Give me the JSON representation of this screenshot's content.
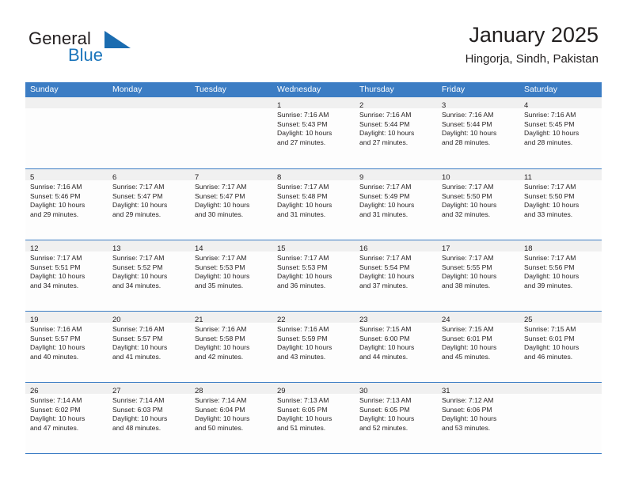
{
  "brand": {
    "general": "General",
    "blue": "Blue",
    "triangle_color": "#1b6cb0",
    "blue_color": "#1b75bb"
  },
  "header": {
    "title": "January 2025",
    "location": "Hingorja, Sindh, Pakistan"
  },
  "theme": {
    "header_blue": "#3c7dc4",
    "day_band_gray": "#f0f0f0",
    "cell_white": "#fdfdfd",
    "text_black": "#231f20"
  },
  "weekday_headers": [
    "Sunday",
    "Monday",
    "Tuesday",
    "Wednesday",
    "Thursday",
    "Friday",
    "Saturday"
  ],
  "weeks": [
    [
      {
        "day": "",
        "empty": true
      },
      {
        "day": "",
        "empty": true
      },
      {
        "day": "",
        "empty": true
      },
      {
        "day": "1",
        "sunrise": "Sunrise: 7:16 AM",
        "sunset": "Sunset: 5:43 PM",
        "daylight1": "Daylight: 10 hours",
        "daylight2": "and 27 minutes."
      },
      {
        "day": "2",
        "sunrise": "Sunrise: 7:16 AM",
        "sunset": "Sunset: 5:44 PM",
        "daylight1": "Daylight: 10 hours",
        "daylight2": "and 27 minutes."
      },
      {
        "day": "3",
        "sunrise": "Sunrise: 7:16 AM",
        "sunset": "Sunset: 5:44 PM",
        "daylight1": "Daylight: 10 hours",
        "daylight2": "and 28 minutes."
      },
      {
        "day": "4",
        "sunrise": "Sunrise: 7:16 AM",
        "sunset": "Sunset: 5:45 PM",
        "daylight1": "Daylight: 10 hours",
        "daylight2": "and 28 minutes."
      }
    ],
    [
      {
        "day": "5",
        "sunrise": "Sunrise: 7:16 AM",
        "sunset": "Sunset: 5:46 PM",
        "daylight1": "Daylight: 10 hours",
        "daylight2": "and 29 minutes."
      },
      {
        "day": "6",
        "sunrise": "Sunrise: 7:17 AM",
        "sunset": "Sunset: 5:47 PM",
        "daylight1": "Daylight: 10 hours",
        "daylight2": "and 29 minutes."
      },
      {
        "day": "7",
        "sunrise": "Sunrise: 7:17 AM",
        "sunset": "Sunset: 5:47 PM",
        "daylight1": "Daylight: 10 hours",
        "daylight2": "and 30 minutes."
      },
      {
        "day": "8",
        "sunrise": "Sunrise: 7:17 AM",
        "sunset": "Sunset: 5:48 PM",
        "daylight1": "Daylight: 10 hours",
        "daylight2": "and 31 minutes."
      },
      {
        "day": "9",
        "sunrise": "Sunrise: 7:17 AM",
        "sunset": "Sunset: 5:49 PM",
        "daylight1": "Daylight: 10 hours",
        "daylight2": "and 31 minutes."
      },
      {
        "day": "10",
        "sunrise": "Sunrise: 7:17 AM",
        "sunset": "Sunset: 5:50 PM",
        "daylight1": "Daylight: 10 hours",
        "daylight2": "and 32 minutes."
      },
      {
        "day": "11",
        "sunrise": "Sunrise: 7:17 AM",
        "sunset": "Sunset: 5:50 PM",
        "daylight1": "Daylight: 10 hours",
        "daylight2": "and 33 minutes."
      }
    ],
    [
      {
        "day": "12",
        "sunrise": "Sunrise: 7:17 AM",
        "sunset": "Sunset: 5:51 PM",
        "daylight1": "Daylight: 10 hours",
        "daylight2": "and 34 minutes."
      },
      {
        "day": "13",
        "sunrise": "Sunrise: 7:17 AM",
        "sunset": "Sunset: 5:52 PM",
        "daylight1": "Daylight: 10 hours",
        "daylight2": "and 34 minutes."
      },
      {
        "day": "14",
        "sunrise": "Sunrise: 7:17 AM",
        "sunset": "Sunset: 5:53 PM",
        "daylight1": "Daylight: 10 hours",
        "daylight2": "and 35 minutes."
      },
      {
        "day": "15",
        "sunrise": "Sunrise: 7:17 AM",
        "sunset": "Sunset: 5:53 PM",
        "daylight1": "Daylight: 10 hours",
        "daylight2": "and 36 minutes."
      },
      {
        "day": "16",
        "sunrise": "Sunrise: 7:17 AM",
        "sunset": "Sunset: 5:54 PM",
        "daylight1": "Daylight: 10 hours",
        "daylight2": "and 37 minutes."
      },
      {
        "day": "17",
        "sunrise": "Sunrise: 7:17 AM",
        "sunset": "Sunset: 5:55 PM",
        "daylight1": "Daylight: 10 hours",
        "daylight2": "and 38 minutes."
      },
      {
        "day": "18",
        "sunrise": "Sunrise: 7:17 AM",
        "sunset": "Sunset: 5:56 PM",
        "daylight1": "Daylight: 10 hours",
        "daylight2": "and 39 minutes."
      }
    ],
    [
      {
        "day": "19",
        "sunrise": "Sunrise: 7:16 AM",
        "sunset": "Sunset: 5:57 PM",
        "daylight1": "Daylight: 10 hours",
        "daylight2": "and 40 minutes."
      },
      {
        "day": "20",
        "sunrise": "Sunrise: 7:16 AM",
        "sunset": "Sunset: 5:57 PM",
        "daylight1": "Daylight: 10 hours",
        "daylight2": "and 41 minutes."
      },
      {
        "day": "21",
        "sunrise": "Sunrise: 7:16 AM",
        "sunset": "Sunset: 5:58 PM",
        "daylight1": "Daylight: 10 hours",
        "daylight2": "and 42 minutes."
      },
      {
        "day": "22",
        "sunrise": "Sunrise: 7:16 AM",
        "sunset": "Sunset: 5:59 PM",
        "daylight1": "Daylight: 10 hours",
        "daylight2": "and 43 minutes."
      },
      {
        "day": "23",
        "sunrise": "Sunrise: 7:15 AM",
        "sunset": "Sunset: 6:00 PM",
        "daylight1": "Daylight: 10 hours",
        "daylight2": "and 44 minutes."
      },
      {
        "day": "24",
        "sunrise": "Sunrise: 7:15 AM",
        "sunset": "Sunset: 6:01 PM",
        "daylight1": "Daylight: 10 hours",
        "daylight2": "and 45 minutes."
      },
      {
        "day": "25",
        "sunrise": "Sunrise: 7:15 AM",
        "sunset": "Sunset: 6:01 PM",
        "daylight1": "Daylight: 10 hours",
        "daylight2": "and 46 minutes."
      }
    ],
    [
      {
        "day": "26",
        "sunrise": "Sunrise: 7:14 AM",
        "sunset": "Sunset: 6:02 PM",
        "daylight1": "Daylight: 10 hours",
        "daylight2": "and 47 minutes."
      },
      {
        "day": "27",
        "sunrise": "Sunrise: 7:14 AM",
        "sunset": "Sunset: 6:03 PM",
        "daylight1": "Daylight: 10 hours",
        "daylight2": "and 48 minutes."
      },
      {
        "day": "28",
        "sunrise": "Sunrise: 7:14 AM",
        "sunset": "Sunset: 6:04 PM",
        "daylight1": "Daylight: 10 hours",
        "daylight2": "and 50 minutes."
      },
      {
        "day": "29",
        "sunrise": "Sunrise: 7:13 AM",
        "sunset": "Sunset: 6:05 PM",
        "daylight1": "Daylight: 10 hours",
        "daylight2": "and 51 minutes."
      },
      {
        "day": "30",
        "sunrise": "Sunrise: 7:13 AM",
        "sunset": "Sunset: 6:05 PM",
        "daylight1": "Daylight: 10 hours",
        "daylight2": "and 52 minutes."
      },
      {
        "day": "31",
        "sunrise": "Sunrise: 7:12 AM",
        "sunset": "Sunset: 6:06 PM",
        "daylight1": "Daylight: 10 hours",
        "daylight2": "and 53 minutes."
      },
      {
        "day": "",
        "empty": true
      }
    ]
  ]
}
